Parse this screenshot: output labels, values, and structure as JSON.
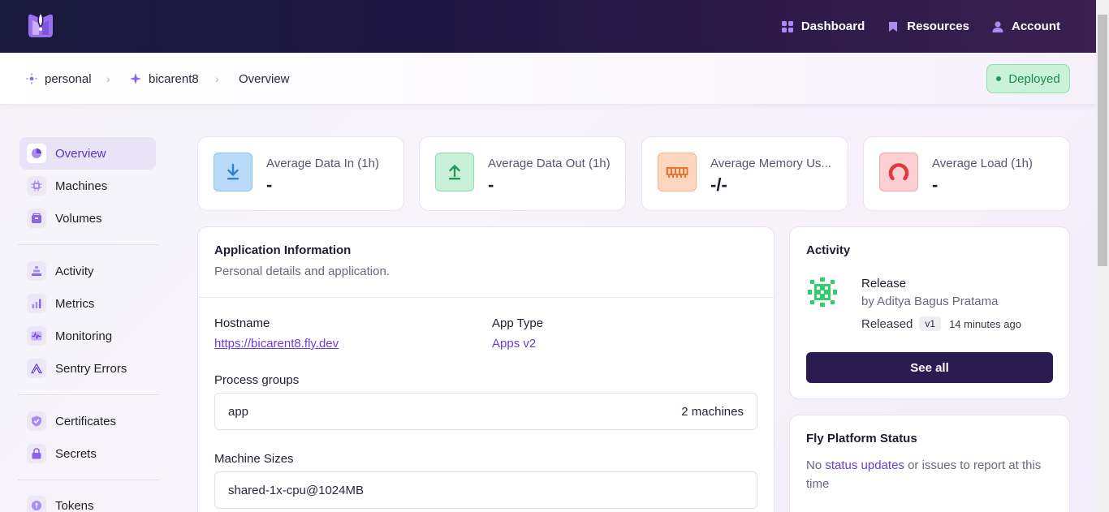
{
  "nav": {
    "logo": "logo",
    "links": [
      {
        "label": "Dashboard",
        "icon": "grid-icon"
      },
      {
        "label": "Resources",
        "icon": "bookmark-icon"
      },
      {
        "label": "Account",
        "icon": "user-icon"
      }
    ]
  },
  "breadcrumb": {
    "items": [
      {
        "label": "personal",
        "icon": "org-icon"
      },
      {
        "label": "bicarent8",
        "icon": "sparkle-icon"
      },
      {
        "label": "Overview"
      }
    ],
    "separator": "›",
    "status": "Deployed"
  },
  "sidebar": {
    "items": [
      {
        "label": "Overview",
        "icon": "chart-pie-icon",
        "active": true
      },
      {
        "label": "Machines",
        "icon": "cpu-icon"
      },
      {
        "label": "Volumes",
        "icon": "volume-icon"
      },
      {
        "label": "Activity",
        "icon": "stack-icon"
      },
      {
        "label": "Metrics",
        "icon": "bar-chart-icon"
      },
      {
        "label": "Monitoring",
        "icon": "pulse-icon"
      },
      {
        "label": "Sentry Errors",
        "icon": "sentry-icon"
      },
      {
        "label": "Certificates",
        "icon": "shield-check-icon"
      },
      {
        "label": "Secrets",
        "icon": "lock-icon"
      },
      {
        "label": "Tokens",
        "icon": "token-icon"
      }
    ]
  },
  "stats": [
    {
      "label": "Average Data In (1h)",
      "value": "-",
      "icon": "download-icon",
      "color": "#b9daf9"
    },
    {
      "label": "Average Data Out (1h)",
      "value": "-",
      "icon": "upload-icon",
      "color": "#c8f0d9"
    },
    {
      "label": "Average Memory Us...",
      "value": "-/-",
      "icon": "memory-icon",
      "color": "#fcd6bf"
    },
    {
      "label": "Average Load (1h)",
      "value": "-",
      "icon": "gauge-icon",
      "color": "#fcd0d3"
    }
  ],
  "app_info": {
    "title": "Application Information",
    "subtitle": "Personal details and application.",
    "hostname_label": "Hostname",
    "hostname_value": "https://bicarent8.fly.dev",
    "apptype_label": "App Type",
    "apptype_value": "Apps v2",
    "process_groups_label": "Process groups",
    "process_group_name": "app",
    "process_group_count": "2 machines",
    "machine_sizes_label": "Machine Sizes",
    "machine_size_value": "shared-1x-cpu@1024MB"
  },
  "activity": {
    "title": "Activity",
    "event_title": "Release",
    "event_by": "by Aditya Bagus Pratama",
    "event_status": "Released",
    "event_version": "v1",
    "event_time": "14 minutes ago",
    "see_all": "See all"
  },
  "platform": {
    "title": "Fly Platform Status",
    "text_before": "No ",
    "link": "status updates",
    "text_after": " or issues to report at this time"
  }
}
